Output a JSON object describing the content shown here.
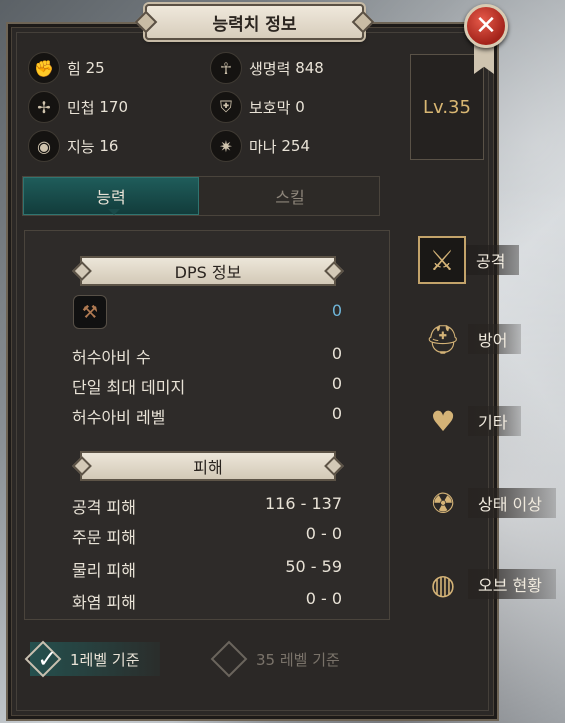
{
  "window": {
    "title": "능력치 정보",
    "close_symbol": "✕"
  },
  "stats": [
    {
      "icon": "fist-icon",
      "glyph": "✊",
      "label": "힘",
      "value": "25"
    },
    {
      "icon": "ankh-icon",
      "glyph": "☥",
      "label": "생명력",
      "value": "848"
    },
    {
      "icon": "triskelion-icon",
      "glyph": "✢",
      "label": "민첩",
      "value": "170"
    },
    {
      "icon": "shield-icon",
      "glyph": "⛨",
      "label": "보호막",
      "value": "0"
    },
    {
      "icon": "eye-icon",
      "glyph": "◉",
      "label": "지능",
      "value": "16"
    },
    {
      "icon": "star-burst-icon",
      "glyph": "✷",
      "label": "마나",
      "value": "254"
    }
  ],
  "level": "Lv.35",
  "tabs": {
    "active": "능력",
    "inactive": "스킬"
  },
  "dps": {
    "heading": "DPS 정보",
    "icon_value": "0",
    "rows": [
      {
        "label": "허수아비 수",
        "value": "0"
      },
      {
        "label": "단일 최대 데미지",
        "value": "0"
      },
      {
        "label": "허수아비 레벨",
        "value": "0"
      }
    ]
  },
  "damage": {
    "heading": "피해",
    "rows": [
      {
        "label": "공격 피해",
        "value": "116 - 137"
      },
      {
        "label": "주문 피해",
        "value": "0 - 0"
      },
      {
        "label": "물리 피해",
        "value": "50 - 59"
      },
      {
        "label": "화염 피해",
        "value": "0 - 0"
      }
    ]
  },
  "basis": {
    "level1": "1레벨 기준",
    "level35": "35 레벨 기준",
    "check_symbol": "✓"
  },
  "side_menu": [
    {
      "icon": "crossed-swords-icon",
      "glyph": "⚔",
      "label": "공격"
    },
    {
      "icon": "helmet-icon",
      "glyph": "⛑",
      "label": "방어"
    },
    {
      "icon": "heartbeat-icon",
      "glyph": "♥",
      "label": "기타"
    },
    {
      "icon": "status-drop-icon",
      "glyph": "☢",
      "label": "상태 이상"
    },
    {
      "icon": "orb-icon",
      "glyph": "◍",
      "label": "오브 현황"
    }
  ],
  "colors": {
    "accent_teal": "#1f5c5a",
    "level_gold": "#d9b773",
    "dps_value_blue": "#6fb5d8",
    "close_red": "#c0362b"
  }
}
